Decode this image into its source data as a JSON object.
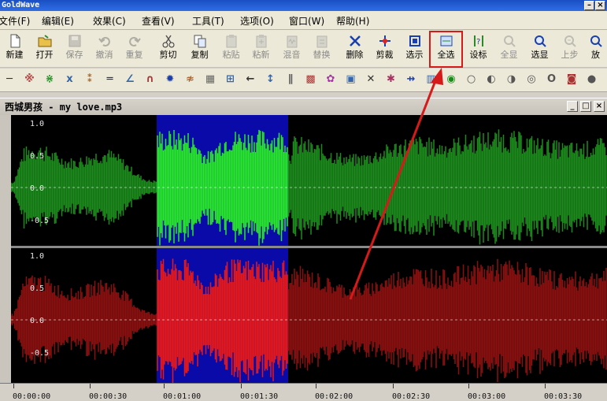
{
  "app": {
    "title": "GoldWave"
  },
  "menu": [
    {
      "label": "文件(F)"
    },
    {
      "label": "编辑(E)"
    },
    {
      "label": "效果(C)"
    },
    {
      "label": "查看(V)"
    },
    {
      "label": "工具(T)"
    },
    {
      "label": "选项(O)"
    },
    {
      "label": "窗口(W)"
    },
    {
      "label": "帮助(H)"
    }
  ],
  "toolbar1": [
    {
      "label": "新建",
      "icon": "new-file-icon",
      "enabled": true
    },
    {
      "label": "打开",
      "icon": "open-folder-icon",
      "enabled": true
    },
    {
      "label": "保存",
      "icon": "save-icon",
      "enabled": false
    },
    {
      "label": "撤消",
      "icon": "undo-icon",
      "enabled": false
    },
    {
      "label": "重复",
      "icon": "redo-icon",
      "enabled": false
    },
    {
      "label": "剪切",
      "icon": "scissors-icon",
      "enabled": true
    },
    {
      "label": "复制",
      "icon": "copy-icon",
      "enabled": true
    },
    {
      "label": "粘贴",
      "icon": "paste-icon",
      "enabled": false
    },
    {
      "label": "粘新",
      "icon": "paste-new-icon",
      "enabled": false
    },
    {
      "label": "混音",
      "icon": "mix-icon",
      "enabled": false
    },
    {
      "label": "替换",
      "icon": "replace-icon",
      "enabled": false
    },
    {
      "label": "删除",
      "icon": "delete-icon",
      "enabled": true
    },
    {
      "label": "剪裁",
      "icon": "trim-icon",
      "enabled": true
    },
    {
      "label": "选示",
      "icon": "select-view-icon",
      "enabled": true
    },
    {
      "label": "全选",
      "icon": "select-all-icon",
      "enabled": true
    },
    {
      "label": "设标",
      "icon": "set-marker-icon",
      "enabled": true
    },
    {
      "label": "全显",
      "icon": "show-all-icon",
      "enabled": false
    },
    {
      "label": "选显",
      "icon": "zoom-selection-icon",
      "enabled": true
    },
    {
      "label": "上步",
      "icon": "zoom-previous-icon",
      "enabled": false
    },
    {
      "label": "放",
      "icon": "zoom-in-icon",
      "enabled": true
    }
  ],
  "toolbar2_icons": [
    "line-icon",
    "effect-1-icon",
    "effect-2-icon",
    "effect-3-icon",
    "effect-4-icon",
    "effect-5-icon",
    "effect-6-icon",
    "effect-7-icon",
    "effect-8-icon",
    "effect-9-icon",
    "effect-10-icon",
    "effect-11-icon",
    "left-arrow-icon",
    "up-down-arrow-icon",
    "effect-12-icon",
    "effect-13-icon",
    "effect-14-icon",
    "effect-15-icon",
    "effect-16-icon",
    "effect-17-icon",
    "effect-18-icon",
    "effect-19-icon",
    "effect-20-icon",
    "effect-21-icon",
    "effect-22-icon",
    "effect-23-icon",
    "effect-24-icon",
    "effect-25-icon",
    "effect-26-icon",
    "effect-27-icon"
  ],
  "document": {
    "title": "西城男孩 - my love.mp3"
  },
  "channels": {
    "top_y_labels": [
      "1.0",
      "0.5",
      "0.0",
      "-0.5"
    ],
    "bottom_y_labels": [
      "1.0",
      "0.5",
      "0.0",
      "-0.5"
    ],
    "top_color": "#1c8a1c",
    "top_selected_color": "#28e828",
    "bottom_color": "#8a1010",
    "bottom_selected_color": "#e81818",
    "selection_background": "#0a0aa8",
    "selection_start_fraction": 0.245,
    "selection_end_fraction": 0.465
  },
  "timeline": {
    "labels": [
      "00:00:00",
      "00:00:30",
      "00:01:00",
      "00:01:30",
      "00:02:00",
      "00:02:30",
      "00:03:00",
      "00:03:30"
    ]
  },
  "annotation": {
    "highlight_target": "全选",
    "color": "#d61a1a"
  }
}
